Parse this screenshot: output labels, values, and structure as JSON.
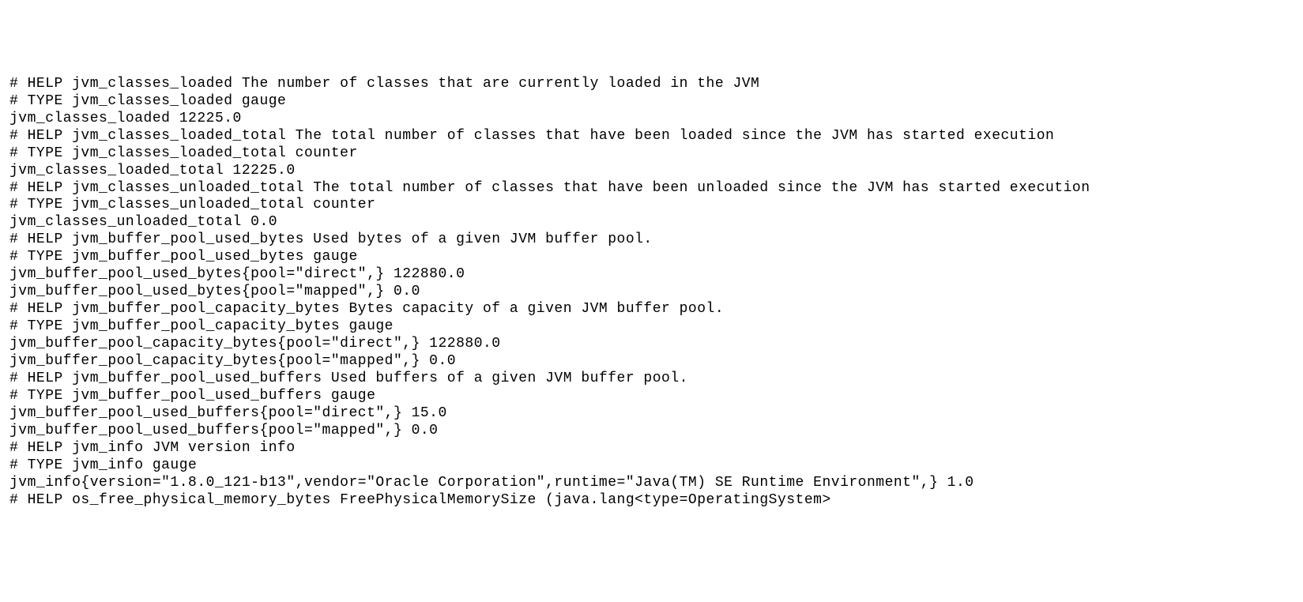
{
  "metrics_text": "# HELP jvm_classes_loaded The number of classes that are currently loaded in the JVM\n# TYPE jvm_classes_loaded gauge\njvm_classes_loaded 12225.0\n# HELP jvm_classes_loaded_total The total number of classes that have been loaded since the JVM has started execution\n# TYPE jvm_classes_loaded_total counter\njvm_classes_loaded_total 12225.0\n# HELP jvm_classes_unloaded_total The total number of classes that have been unloaded since the JVM has started execution\n# TYPE jvm_classes_unloaded_total counter\njvm_classes_unloaded_total 0.0\n# HELP jvm_buffer_pool_used_bytes Used bytes of a given JVM buffer pool.\n# TYPE jvm_buffer_pool_used_bytes gauge\njvm_buffer_pool_used_bytes{pool=\"direct\",} 122880.0\njvm_buffer_pool_used_bytes{pool=\"mapped\",} 0.0\n# HELP jvm_buffer_pool_capacity_bytes Bytes capacity of a given JVM buffer pool.\n# TYPE jvm_buffer_pool_capacity_bytes gauge\njvm_buffer_pool_capacity_bytes{pool=\"direct\",} 122880.0\njvm_buffer_pool_capacity_bytes{pool=\"mapped\",} 0.0\n# HELP jvm_buffer_pool_used_buffers Used buffers of a given JVM buffer pool.\n# TYPE jvm_buffer_pool_used_buffers gauge\njvm_buffer_pool_used_buffers{pool=\"direct\",} 15.0\njvm_buffer_pool_used_buffers{pool=\"mapped\",} 0.0\n# HELP jvm_info JVM version info\n# TYPE jvm_info gauge\njvm_info{version=\"1.8.0_121-b13\",vendor=\"Oracle Corporation\",runtime=\"Java(TM) SE Runtime Environment\",} 1.0\n# HELP os_free_physical_memory_bytes FreePhysicalMemorySize (java.lang<type=OperatingSystem>"
}
